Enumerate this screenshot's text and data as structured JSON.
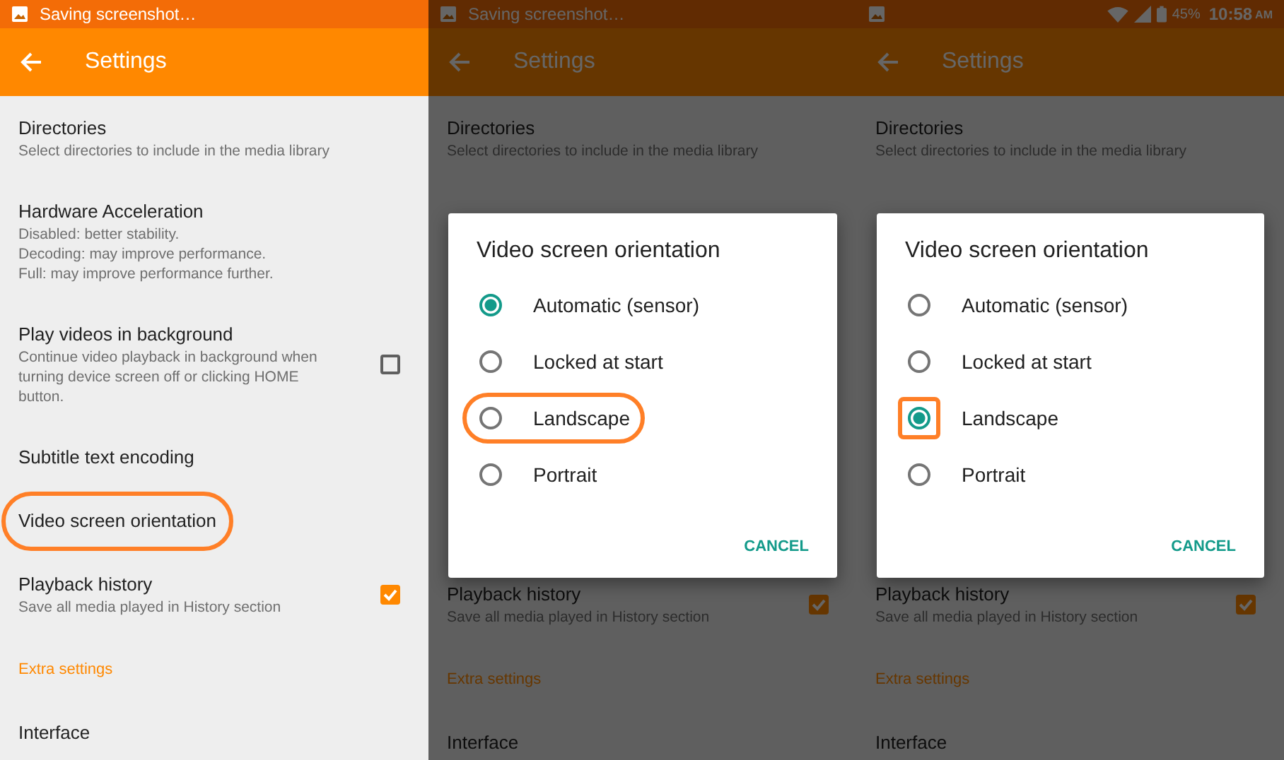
{
  "panels": [
    {
      "status_bar": {
        "text": "Saving screenshot…"
      },
      "toolbar": {
        "title": "Settings"
      },
      "settings": [
        {
          "kind": "plain",
          "title": "Directories",
          "description": [
            "Select directories to include in the media library"
          ],
          "highlighted": false
        },
        {
          "kind": "plain",
          "title": "Hardware Acceleration",
          "description": [
            "Disabled: better stability.",
            "Decoding: may improve performance.",
            "Full: may improve performance further."
          ],
          "highlighted": false
        },
        {
          "kind": "checkbox",
          "title": "Play videos in background",
          "description": [
            "Continue video playback in background when turning device screen off or clicking HOME button."
          ],
          "checked": false,
          "highlighted": false
        },
        {
          "kind": "plain",
          "title": "Subtitle text encoding",
          "highlighted": false
        },
        {
          "kind": "plain",
          "title": "Video screen orientation",
          "highlighted": true
        },
        {
          "kind": "checkbox",
          "title": "Playback history",
          "description": [
            "Save all media played in History section"
          ],
          "checked": true,
          "highlighted": false
        },
        {
          "kind": "header",
          "title": "Extra settings",
          "highlighted": false
        },
        {
          "kind": "plain",
          "title": "Interface",
          "highlighted": false
        }
      ]
    },
    {
      "status_bar": {
        "text": "Saving screenshot…"
      },
      "toolbar": {
        "title": "Settings"
      },
      "settings": [
        {
          "kind": "plain",
          "title": "Directories",
          "description": [
            "Select directories to include in the media library"
          ],
          "highlighted": false
        }
      ],
      "dialog": {
        "title": "Video screen orientation",
        "options": [
          {
            "label": "Automatic (sensor)",
            "selected": true,
            "highlighted": false,
            "radio_highlighted": false
          },
          {
            "label": "Locked at start",
            "selected": false,
            "highlighted": false,
            "radio_highlighted": false
          },
          {
            "label": "Landscape",
            "selected": false,
            "highlighted": true,
            "radio_highlighted": false
          },
          {
            "label": "Portrait",
            "selected": false,
            "highlighted": false,
            "radio_highlighted": false
          }
        ],
        "button": "CANCEL"
      },
      "settings_below": [
        {
          "kind": "checkbox",
          "title": "Playback history",
          "description": [
            "Save all media played in History section"
          ],
          "checked": true,
          "highlighted": false
        },
        {
          "kind": "header",
          "title": "Extra settings",
          "highlighted": false
        },
        {
          "kind": "plain",
          "title": "Interface",
          "highlighted": false
        }
      ]
    },
    {
      "status_bar": {
        "battery": "45%",
        "time": "10:58",
        "period": "AM"
      },
      "toolbar": {
        "title": "Settings"
      },
      "settings": [
        {
          "kind": "plain",
          "title": "Directories",
          "description": [
            "Select directories to include in the media library"
          ],
          "highlighted": false
        }
      ],
      "dialog": {
        "title": "Video screen orientation",
        "options": [
          {
            "label": "Automatic (sensor)",
            "selected": false,
            "highlighted": false,
            "radio_highlighted": false
          },
          {
            "label": "Locked at start",
            "selected": false,
            "highlighted": false,
            "radio_highlighted": false
          },
          {
            "label": "Landscape",
            "selected": true,
            "highlighted": false,
            "radio_highlighted": true
          },
          {
            "label": "Portrait",
            "selected": false,
            "highlighted": false,
            "radio_highlighted": false
          }
        ],
        "button": "CANCEL"
      },
      "settings_below": [
        {
          "kind": "checkbox",
          "title": "Playback history",
          "description": [
            "Save all media played in History section"
          ],
          "checked": true,
          "highlighted": false
        },
        {
          "kind": "header",
          "title": "Extra settings",
          "highlighted": false
        },
        {
          "kind": "plain",
          "title": "Interface",
          "highlighted": false
        }
      ]
    }
  ]
}
